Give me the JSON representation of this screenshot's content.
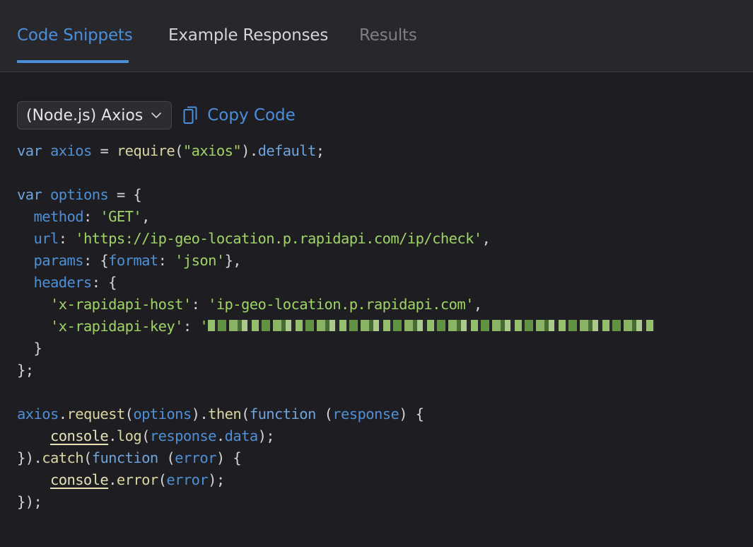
{
  "tabs": [
    {
      "label": "Code Snippets",
      "state": "active"
    },
    {
      "label": "Example Responses",
      "state": "normal"
    },
    {
      "label": "Results",
      "state": "muted"
    }
  ],
  "toolbar": {
    "language_select_value": "(Node.js) Axios",
    "copy_label": "Copy Code"
  },
  "colors": {
    "accent": "#4a8fdc",
    "string": "#9fd366",
    "background": "#1e1e22"
  },
  "code": {
    "lines": [
      [
        {
          "t": "kw",
          "v": "var"
        },
        {
          "t": "pun",
          "v": " "
        },
        {
          "t": "var",
          "v": "axios"
        },
        {
          "t": "pun",
          "v": " = "
        },
        {
          "t": "fn",
          "v": "require"
        },
        {
          "t": "pun",
          "v": "("
        },
        {
          "t": "str",
          "v": "\"axios\""
        },
        {
          "t": "pun",
          "v": ")."
        },
        {
          "t": "kw",
          "v": "default"
        },
        {
          "t": "pun",
          "v": ";"
        }
      ],
      [],
      [
        {
          "t": "kw",
          "v": "var"
        },
        {
          "t": "pun",
          "v": " "
        },
        {
          "t": "var",
          "v": "options"
        },
        {
          "t": "pun",
          "v": " = {"
        }
      ],
      [
        {
          "t": "pun",
          "v": "  "
        },
        {
          "t": "prop",
          "v": "method"
        },
        {
          "t": "pun",
          "v": ": "
        },
        {
          "t": "str",
          "v": "'GET'"
        },
        {
          "t": "pun",
          "v": ","
        }
      ],
      [
        {
          "t": "pun",
          "v": "  "
        },
        {
          "t": "prop",
          "v": "url"
        },
        {
          "t": "pun",
          "v": ": "
        },
        {
          "t": "str",
          "v": "'https://ip-geo-location.p.rapidapi.com/ip/check'"
        },
        {
          "t": "pun",
          "v": ","
        }
      ],
      [
        {
          "t": "pun",
          "v": "  "
        },
        {
          "t": "prop",
          "v": "params"
        },
        {
          "t": "pun",
          "v": ": {"
        },
        {
          "t": "prop",
          "v": "format"
        },
        {
          "t": "pun",
          "v": ": "
        },
        {
          "t": "str",
          "v": "'json'"
        },
        {
          "t": "pun",
          "v": "},"
        }
      ],
      [
        {
          "t": "pun",
          "v": "  "
        },
        {
          "t": "prop",
          "v": "headers"
        },
        {
          "t": "pun",
          "v": ": {"
        }
      ],
      [
        {
          "t": "pun",
          "v": "    "
        },
        {
          "t": "str",
          "v": "'x-rapidapi-host'"
        },
        {
          "t": "pun",
          "v": ": "
        },
        {
          "t": "str",
          "v": "'ip-geo-location.p.rapidapi.com'"
        },
        {
          "t": "pun",
          "v": ","
        }
      ],
      [
        {
          "t": "pun",
          "v": "    "
        },
        {
          "t": "str",
          "v": "'x-rapidapi-key'"
        },
        {
          "t": "pun",
          "v": ": "
        },
        {
          "t": "str",
          "v": "'"
        },
        {
          "t": "redacted",
          "v": ""
        }
      ],
      [
        {
          "t": "pun",
          "v": "  }"
        }
      ],
      [
        {
          "t": "pun",
          "v": "};"
        }
      ],
      [],
      [
        {
          "t": "var",
          "v": "axios"
        },
        {
          "t": "pun",
          "v": "."
        },
        {
          "t": "fn",
          "v": "request"
        },
        {
          "t": "pun",
          "v": "("
        },
        {
          "t": "var",
          "v": "options"
        },
        {
          "t": "pun",
          "v": ")."
        },
        {
          "t": "fn",
          "v": "then"
        },
        {
          "t": "pun",
          "v": "("
        },
        {
          "t": "kw",
          "v": "function"
        },
        {
          "t": "pun",
          "v": " ("
        },
        {
          "t": "var",
          "v": "response"
        },
        {
          "t": "pun",
          "v": ") {"
        }
      ],
      [
        {
          "t": "pun",
          "v": "    "
        },
        {
          "t": "obj",
          "v": "console"
        },
        {
          "t": "pun",
          "v": "."
        },
        {
          "t": "fn",
          "v": "log"
        },
        {
          "t": "pun",
          "v": "("
        },
        {
          "t": "var",
          "v": "response"
        },
        {
          "t": "pun",
          "v": "."
        },
        {
          "t": "var",
          "v": "data"
        },
        {
          "t": "pun",
          "v": ");"
        }
      ],
      [
        {
          "t": "pun",
          "v": "})."
        },
        {
          "t": "fn",
          "v": "catch"
        },
        {
          "t": "pun",
          "v": "("
        },
        {
          "t": "kw",
          "v": "function"
        },
        {
          "t": "pun",
          "v": " ("
        },
        {
          "t": "var",
          "v": "error"
        },
        {
          "t": "pun",
          "v": ") {"
        }
      ],
      [
        {
          "t": "pun",
          "v": "    "
        },
        {
          "t": "obj",
          "v": "console"
        },
        {
          "t": "pun",
          "v": "."
        },
        {
          "t": "fn",
          "v": "error"
        },
        {
          "t": "pun",
          "v": "("
        },
        {
          "t": "var",
          "v": "error"
        },
        {
          "t": "pun",
          "v": ");"
        }
      ],
      [
        {
          "t": "pun",
          "v": "});"
        }
      ]
    ]
  }
}
